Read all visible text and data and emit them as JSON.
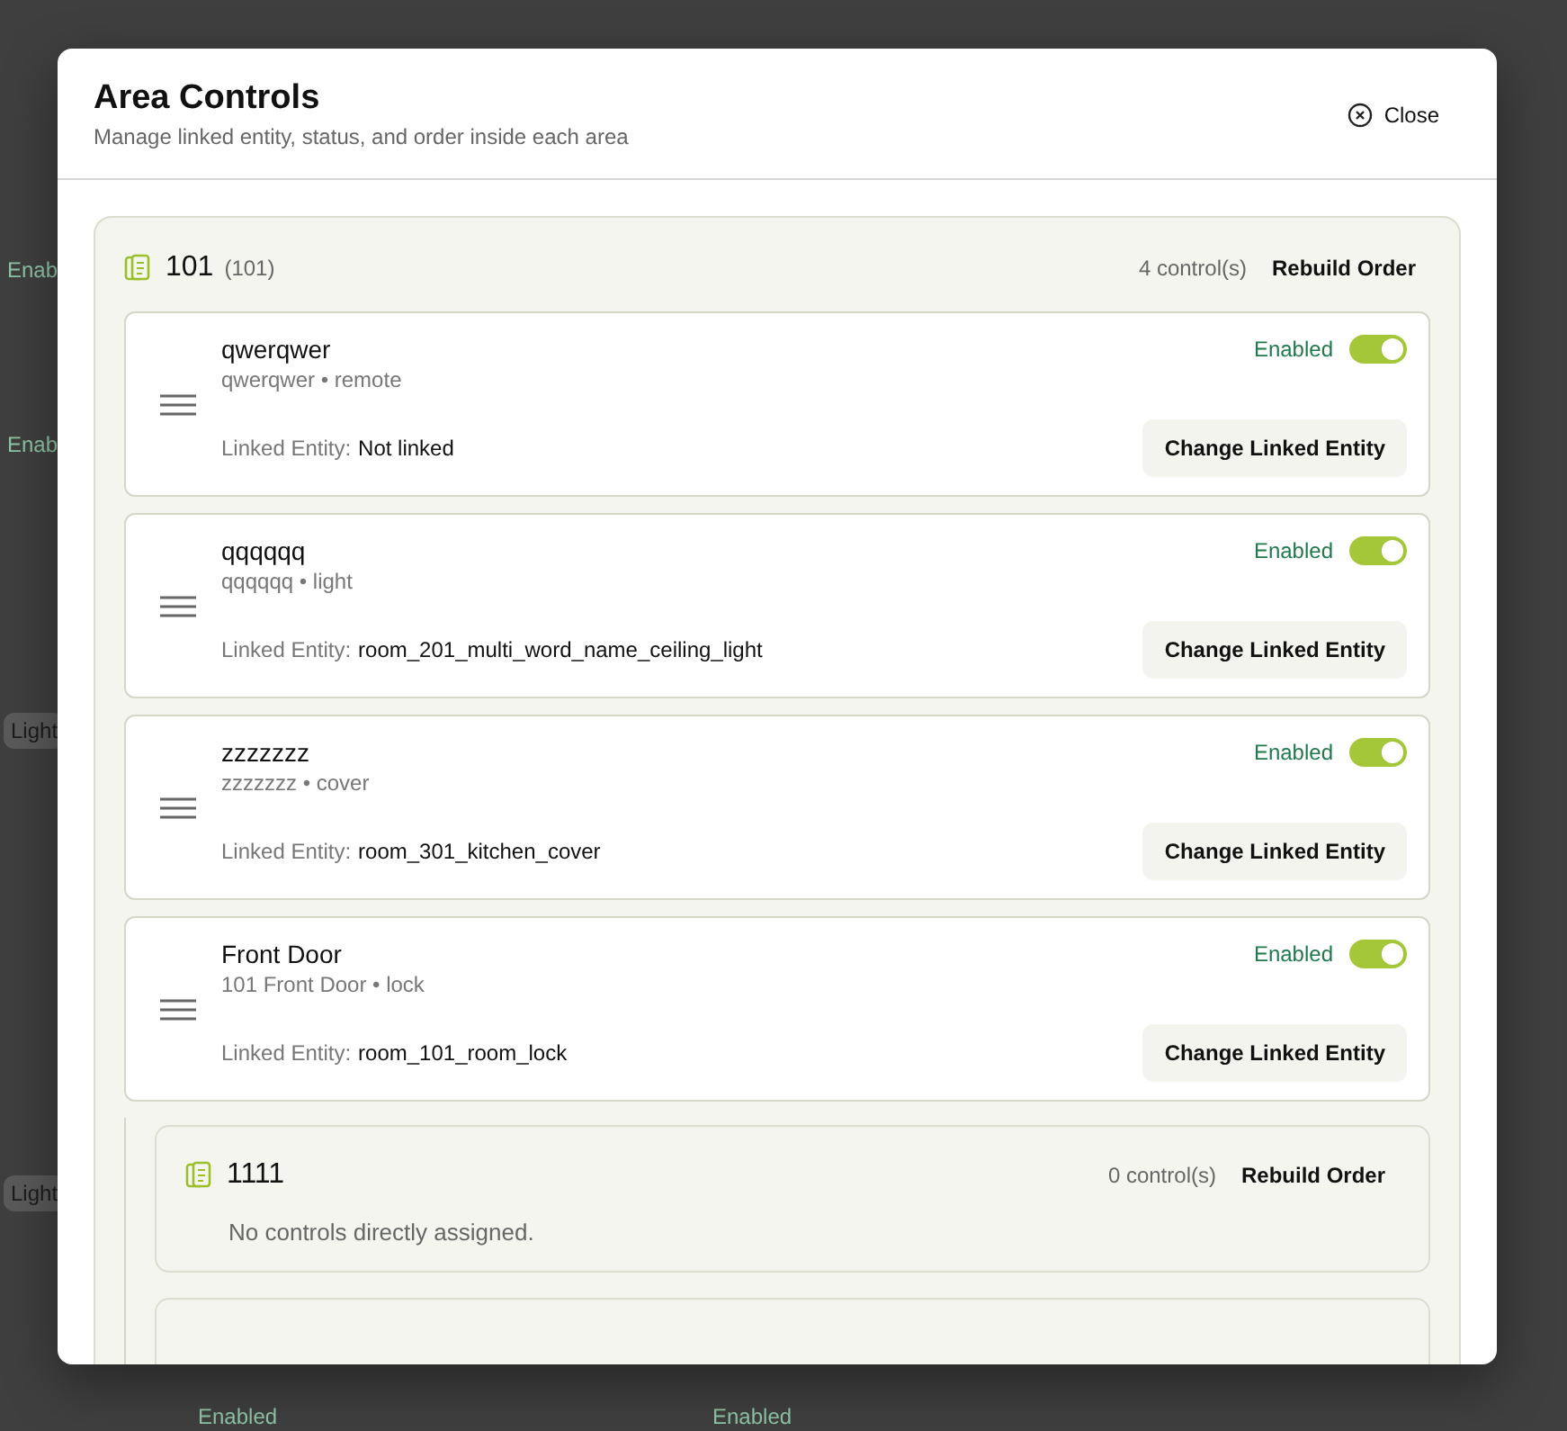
{
  "background": {
    "fragments": [
      {
        "kind": "status",
        "text": "Enab"
      },
      {
        "kind": "status",
        "text": "Enab"
      },
      {
        "kind": "tag",
        "text": "Light"
      },
      {
        "kind": "tag",
        "text": "Light"
      },
      {
        "kind": "status",
        "text": "Enabled"
      },
      {
        "kind": "status",
        "text": "Enabled"
      }
    ]
  },
  "dialog": {
    "title": "Area Controls",
    "subtitle": "Manage linked entity, status, and order inside each area",
    "close_label": "Close"
  },
  "area": {
    "name": "101",
    "code": "(101)",
    "count": "4 control(s)",
    "rebuild_label": "Rebuild Order",
    "controls": [
      {
        "name": "qwerqwer",
        "meta": "qwerqwer • remote",
        "status": "Enabled",
        "on": true,
        "linked_label": "Linked Entity:",
        "linked_value": "Not linked",
        "change_label": "Change Linked Entity"
      },
      {
        "name": "qqqqqq",
        "meta": "qqqqqq • light",
        "status": "Enabled",
        "on": true,
        "linked_label": "Linked Entity:",
        "linked_value": "room_201_multi_word_name_ceiling_light",
        "change_label": "Change Linked Entity"
      },
      {
        "name": "zzzzzzz",
        "meta": "zzzzzzz • cover",
        "status": "Enabled",
        "on": true,
        "linked_label": "Linked Entity:",
        "linked_value": "room_301_kitchen_cover",
        "change_label": "Change Linked Entity"
      },
      {
        "name": "Front Door",
        "meta": "101 Front Door • lock",
        "status": "Enabled",
        "on": true,
        "linked_label": "Linked Entity:",
        "linked_value": "room_101_room_lock",
        "change_label": "Change Linked Entity"
      }
    ],
    "children": [
      {
        "name": "1111",
        "count": "0 control(s)",
        "rebuild_label": "Rebuild Order",
        "empty_text": "No controls directly assigned."
      }
    ]
  }
}
